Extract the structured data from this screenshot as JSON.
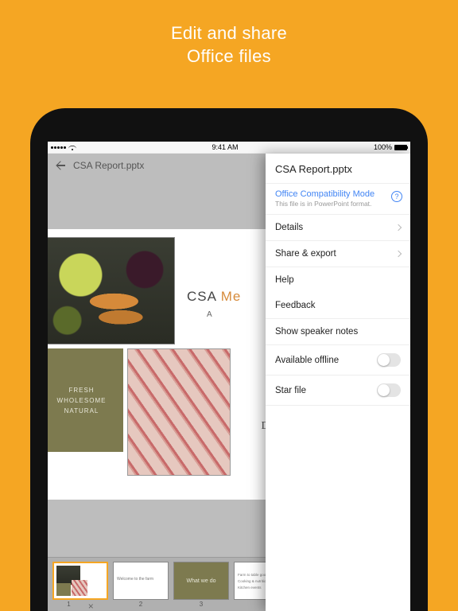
{
  "promo": {
    "line1": "Edit and share",
    "line2": "Office files"
  },
  "statusbar": {
    "carrier_dots": 5,
    "wifi": true,
    "time": "9:41 AM",
    "battery_pct": "100%"
  },
  "editor": {
    "filename": "CSA Report.pptx",
    "slide": {
      "title_a": "CSA ",
      "title_b": "Me",
      "subtitle": "A",
      "greenblock": {
        "l1": "FRESH",
        "l2": "WHOLESOME",
        "l3": "NATURAL"
      },
      "dr": "DR"
    },
    "thumbs": [
      {
        "n": "1",
        "selected": true
      },
      {
        "n": "2",
        "caption": "Welcome to the farm"
      },
      {
        "n": "3",
        "caption": "What we do"
      },
      {
        "n": "",
        "lines": [
          "Farm to table goodness",
          "Cooking & nutrition classes",
          "Kitchen events"
        ]
      }
    ]
  },
  "panel": {
    "title": "CSA Report.pptx",
    "ocm_title": "Office Compatibility Mode",
    "ocm_sub": "This file is in PowerPoint format.",
    "help_glyph": "?",
    "items": {
      "details": "Details",
      "share": "Share & export",
      "help": "Help",
      "feedback": "Feedback",
      "speaker": "Show speaker notes",
      "offline": "Available offline",
      "star": "Star file"
    }
  }
}
